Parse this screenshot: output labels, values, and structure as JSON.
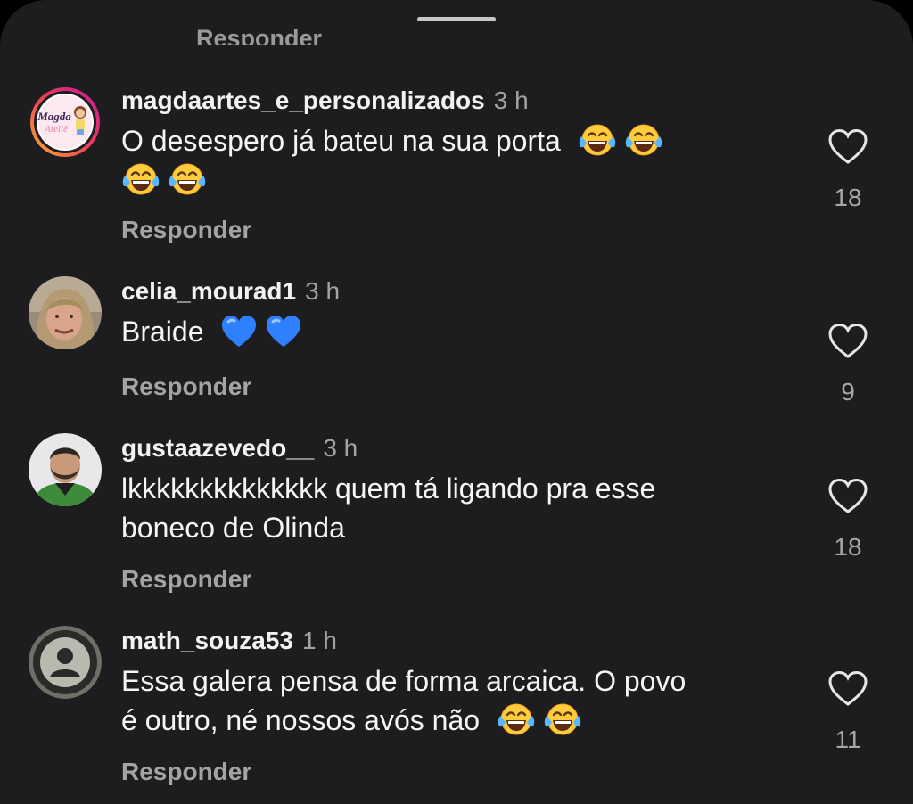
{
  "sheet": {
    "previous_reply_label": "Responder"
  },
  "comments": [
    {
      "username": "magdaartes_e_personalizados",
      "time": "3 h",
      "text": "O desespero já bateu na sua porta",
      "emoji": [
        "face-with-tears-of-joy",
        "face-with-tears-of-joy",
        "face-with-tears-of-joy",
        "face-with-tears-of-joy"
      ],
      "reply_label": "Responder",
      "likes": "18",
      "avatar": {
        "logo_text": "Magda",
        "logo_text2": "Ateliê",
        "has_story_ring": true
      }
    },
    {
      "username": "celia_mourad1",
      "time": "3 h",
      "text": "Braide",
      "emoji": [
        "blue-heart",
        "blue-heart"
      ],
      "reply_label": "Responder",
      "likes": "9",
      "avatar": {
        "kind": "photo-woman"
      }
    },
    {
      "username": "gustaazevedo__",
      "time": "3 h",
      "text_line1": "lkkkkkkkkkkkkkk quem tá ligando pra esse",
      "text_line2": "boneco de Olinda",
      "reply_label": "Responder",
      "likes": "18",
      "avatar": {
        "kind": "photo-man"
      }
    },
    {
      "username": "math_souza53",
      "time": "1 h",
      "text_line1": "Essa galera pensa de forma arcaica. O povo",
      "text_line2": "é outro, né nossos avós não",
      "emoji": [
        "face-with-tears-of-joy",
        "face-with-tears-of-joy"
      ],
      "reply_label": "Responder",
      "likes": "11",
      "avatar": {
        "kind": "default-profile"
      }
    }
  ],
  "colors": {
    "background": "#1d1d1f",
    "username": "#f2f2f2",
    "secondary_text": "#a4a4a7",
    "story_ring_start": "#f9b02f",
    "story_ring_end": "#c8179a",
    "blue_heart": "#2f80ff"
  }
}
